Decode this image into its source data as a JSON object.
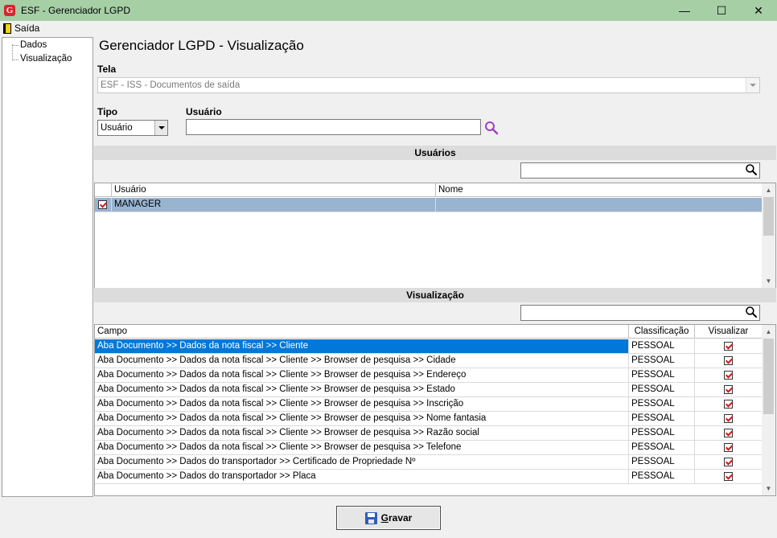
{
  "window": {
    "title": "ESF - Gerenciador LGPD",
    "app_icon": "G",
    "minimize_glyph": "—",
    "maximize_glyph": "☐",
    "close_glyph": "✕"
  },
  "menu": {
    "exit_label": "Saída"
  },
  "tree": {
    "items": [
      "Dados",
      "Visualização"
    ]
  },
  "main": {
    "title": "Gerenciador LGPD - Visualização",
    "tela_label": "Tela",
    "tela_value": "ESF - ISS - Documentos de saída",
    "tipo_label": "Tipo",
    "tipo_value": "Usuário",
    "usuario_label": "Usuário",
    "usuario_value": ""
  },
  "users_section": {
    "header": "Usuários",
    "search_value": "",
    "columns": [
      "Usuário",
      "Nome"
    ],
    "rows": [
      {
        "usuario": "MANAGER",
        "nome": "",
        "checked": true
      }
    ]
  },
  "view_section": {
    "header": "Visualização",
    "search_value": "",
    "columns": [
      "Campo",
      "Classificação",
      "Visualizar"
    ],
    "rows": [
      {
        "campo": "Aba Documento >> Dados da nota fiscal >> Cliente",
        "classificacao": "PESSOAL",
        "visualizar": true
      },
      {
        "campo": "Aba Documento >> Dados da nota fiscal >> Cliente >> Browser de pesquisa >> Cidade",
        "classificacao": "PESSOAL",
        "visualizar": true
      },
      {
        "campo": "Aba Documento >> Dados da nota fiscal >> Cliente >> Browser de pesquisa >> Endereço",
        "classificacao": "PESSOAL",
        "visualizar": true
      },
      {
        "campo": "Aba Documento >> Dados da nota fiscal >> Cliente >> Browser de pesquisa >> Estado",
        "classificacao": "PESSOAL",
        "visualizar": true
      },
      {
        "campo": "Aba Documento >> Dados da nota fiscal >> Cliente >> Browser de pesquisa >> Inscrição",
        "classificacao": "PESSOAL",
        "visualizar": true
      },
      {
        "campo": "Aba Documento >> Dados da nota fiscal >> Cliente >> Browser de pesquisa >> Nome fantasia",
        "classificacao": "PESSOAL",
        "visualizar": true
      },
      {
        "campo": "Aba Documento >> Dados da nota fiscal >> Cliente >> Browser de pesquisa >> Razão social",
        "classificacao": "PESSOAL",
        "visualizar": true
      },
      {
        "campo": "Aba Documento >> Dados da nota fiscal >> Cliente >> Browser de pesquisa >> Telefone",
        "classificacao": "PESSOAL",
        "visualizar": true
      },
      {
        "campo": "Aba Documento >> Dados do transportador >> Certificado de Propriedade Nº",
        "classificacao": "PESSOAL",
        "visualizar": true
      },
      {
        "campo": "Aba Documento >> Dados do transportador >> Placa",
        "classificacao": "PESSOAL",
        "visualizar": true
      }
    ]
  },
  "buttons": {
    "save_label": "Gravar"
  },
  "colors": {
    "titlebar": "#a6cfa6",
    "selected_row_blue": "#0078d7",
    "selected_row_user": "#99b4d1",
    "check_red": "#d8151a",
    "search_icon_purple": "#a13fc2"
  }
}
